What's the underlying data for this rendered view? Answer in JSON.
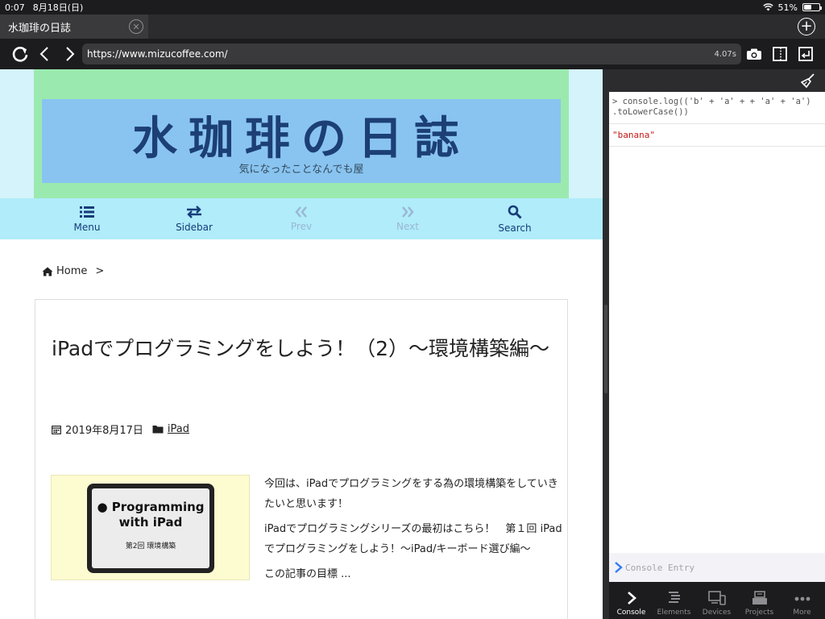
{
  "status": {
    "time": "0:07",
    "date": "8月18日(日)",
    "battery_percent": "51%",
    "battery_level": 0.51
  },
  "tab": {
    "title": "水珈琲の日誌",
    "close_glyph": "✕",
    "new_tab_glyph": "+"
  },
  "toolbar": {
    "url": "https://www.mizucoffee.com/",
    "load_time": "4.07s"
  },
  "site": {
    "title": "水珈琲の日誌",
    "description": "気になったことなんでも屋"
  },
  "nav": [
    {
      "label": "Menu",
      "icon": "list-icon",
      "disabled": false
    },
    {
      "label": "Sidebar",
      "icon": "arrows-exchange-icon",
      "disabled": false
    },
    {
      "label": "Prev",
      "icon": "double-chevron-left-icon",
      "disabled": true
    },
    {
      "label": "Next",
      "icon": "double-chevron-right-icon",
      "disabled": true
    },
    {
      "label": "Search",
      "icon": "search-icon",
      "disabled": false
    }
  ],
  "breadcrumb": {
    "home": "Home",
    "separator": ">"
  },
  "post": {
    "title": "iPadでプログラミングをしよう！（2）〜環境構築編〜",
    "date": "2019年8月17日",
    "category": "iPad",
    "thumbnail": {
      "line1": "Programming",
      "line2": "with iPad",
      "subtitle": "第2回 環境構築"
    },
    "excerpt": [
      "今回は、iPadでプログラミングをする為の環境構築をしていきたいと思います！",
      "iPadでプログラミングシリーズの最初はこちら！　第１回 iPadでプログラミングをしよう！〜iPad/キーボード選び編〜",
      "この記事の目標 ..."
    ]
  },
  "console": {
    "command": "> console.log(('b' + 'a' + + 'a' + 'a')\n.toLowerCase())",
    "output": "\"banana\"",
    "entry_placeholder": "Console Entry"
  },
  "devtabs": [
    {
      "label": "Console",
      "icon": "console-icon",
      "active": true
    },
    {
      "label": "Elements",
      "icon": "elements-icon",
      "active": false
    },
    {
      "label": "Devices",
      "icon": "devices-icon",
      "active": false
    },
    {
      "label": "Projects",
      "icon": "projects-icon",
      "active": false
    },
    {
      "label": "More",
      "icon": "more-icon",
      "active": false
    }
  ]
}
